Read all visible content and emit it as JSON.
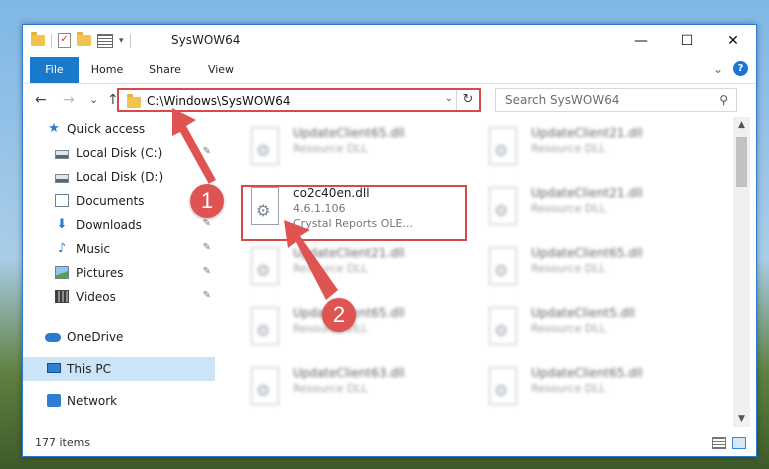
{
  "window": {
    "title": "SysWOW64",
    "minimize_label": "—",
    "maximize_label": "☐",
    "close_label": "✕"
  },
  "ribbon": {
    "tabs": [
      "File",
      "Home",
      "Share",
      "View"
    ],
    "expand_label": "⌄",
    "help_label": "?"
  },
  "address": {
    "path": "C:\\Windows\\SysWOW64",
    "back": "←",
    "forward": "→",
    "recent": "⌄",
    "up": "↑",
    "dropdown": "⌄",
    "refresh": "↻"
  },
  "search": {
    "placeholder": "Search SysWOW64",
    "icon": "⚲"
  },
  "sidebar": {
    "items": [
      {
        "label": "Quick access",
        "icon": "star-icon"
      },
      {
        "label": "Local Disk (C:)",
        "icon": "disk-icon",
        "pinned": true
      },
      {
        "label": "Local Disk (D:)",
        "icon": "disk-icon"
      },
      {
        "label": "Documents",
        "icon": "documents-icon",
        "pinned": true
      },
      {
        "label": "Downloads",
        "icon": "download-icon",
        "pinned": true
      },
      {
        "label": "Music",
        "icon": "music-icon",
        "pinned": true
      },
      {
        "label": "Pictures",
        "icon": "pictures-icon",
        "pinned": true
      },
      {
        "label": "Videos",
        "icon": "videos-icon",
        "pinned": true
      },
      {
        "label": "OneDrive",
        "icon": "onedrive-icon"
      },
      {
        "label": "This PC",
        "icon": "this-pc-icon",
        "selected": true
      },
      {
        "label": "Network",
        "icon": "network-icon"
      }
    ],
    "pin_glyph": "✎",
    "star_glyph": "★",
    "down_glyph": "⬇",
    "music_glyph": "♪"
  },
  "files": {
    "highlighted": {
      "name": "co2c40en.dll",
      "type": "4.6.1.106",
      "desc": "Crystal Reports OLE..."
    },
    "background": [
      {
        "name": "UpdateClient65.dll",
        "type": "Resource DLL"
      },
      {
        "name": "UpdateClient21.dll",
        "type": "Resource DLL"
      },
      {
        "name": "UpdateClient21.dll",
        "type": "Resource DLL"
      },
      {
        "name": "UpdateClient21.dll",
        "type": "Resource DLL"
      },
      {
        "name": "UpdateClient65.dll",
        "type": "Resource DLL"
      },
      {
        "name": "UpdateClient65.dll",
        "type": "Resource DLL"
      },
      {
        "name": "UpdateClient5.dll",
        "type": "Resource DLL"
      },
      {
        "name": "UpdateClient63.dll",
        "type": "Resource DLL"
      },
      {
        "name": "UpdateClient65.dll",
        "type": "Resource DLL"
      }
    ],
    "gear_glyph": "⚙"
  },
  "scroll": {
    "up": "▲",
    "down": "▼"
  },
  "status": {
    "item_count": "177 items"
  },
  "annotations": {
    "badge1": "1",
    "badge2": "2",
    "arrow_color": "#e05353"
  }
}
